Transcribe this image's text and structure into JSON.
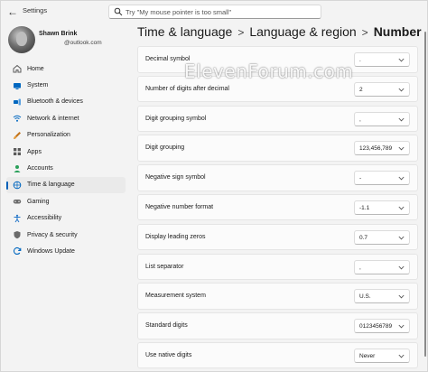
{
  "window": {
    "title": "Settings"
  },
  "search": {
    "placeholder": "Try \"My mouse pointer is too small\""
  },
  "user": {
    "name": "Shawn Brink",
    "email_suffix": "@outlook.com"
  },
  "nav": [
    {
      "label": "Home",
      "icon": "home-icon",
      "color": "#5b5b5b"
    },
    {
      "label": "System",
      "icon": "system-icon",
      "color": "#0067c0"
    },
    {
      "label": "Bluetooth & devices",
      "icon": "bluetooth-icon",
      "color": "#0067c0"
    },
    {
      "label": "Network & internet",
      "icon": "wifi-icon",
      "color": "#0067c0"
    },
    {
      "label": "Personalization",
      "icon": "brush-icon",
      "color": "#c2731b"
    },
    {
      "label": "Apps",
      "icon": "apps-icon",
      "color": "#5b5b5b"
    },
    {
      "label": "Accounts",
      "icon": "person-icon",
      "color": "#2aa05a"
    },
    {
      "label": "Time & language",
      "icon": "globe-clock-icon",
      "color": "#0067c0",
      "active": true
    },
    {
      "label": "Gaming",
      "icon": "gamepad-icon",
      "color": "#6b6b6b"
    },
    {
      "label": "Accessibility",
      "icon": "accessibility-icon",
      "color": "#1f73c8"
    },
    {
      "label": "Privacy & security",
      "icon": "shield-icon",
      "color": "#6b6b6b"
    },
    {
      "label": "Windows Update",
      "icon": "update-icon",
      "color": "#0067c0"
    }
  ],
  "breadcrumb": {
    "part1": "Time & language",
    "part2": "Language & region",
    "current": "Number",
    "separator": ">"
  },
  "watermark": "ElevenForum.com",
  "settings": [
    {
      "label": "Decimal symbol",
      "value": "."
    },
    {
      "label": "Number of digits after decimal",
      "value": "2"
    },
    {
      "label": "Digit grouping symbol",
      "value": ","
    },
    {
      "label": "Digit grouping",
      "value": "123,456,789"
    },
    {
      "label": "Negative sign symbol",
      "value": "-"
    },
    {
      "label": "Negative number format",
      "value": "-1.1"
    },
    {
      "label": "Display leading zeros",
      "value": "0.7"
    },
    {
      "label": "List separator",
      "value": ","
    },
    {
      "label": "Measurement system",
      "value": "U.S."
    },
    {
      "label": "Standard digits",
      "value": "0123456789"
    },
    {
      "label": "Use native digits",
      "value": "Never"
    }
  ]
}
